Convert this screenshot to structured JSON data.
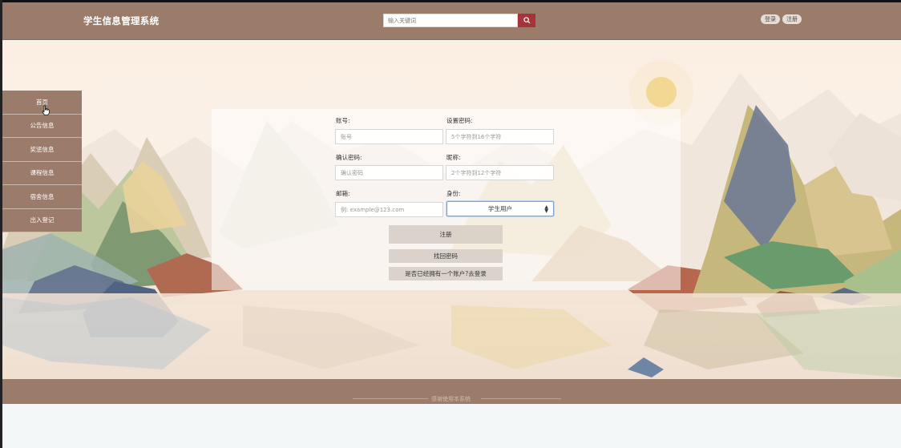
{
  "header": {
    "title": "学生信息管理系统",
    "search_placeholder": "输入关键词",
    "login_label": "登录",
    "register_label": "注册",
    "accent_color": "#9b7b6a",
    "search_button_color": "#a6323a"
  },
  "sidebar": {
    "items": [
      {
        "label": "首页"
      },
      {
        "label": "公告信息"
      },
      {
        "label": "奖惩信息"
      },
      {
        "label": "课程信息"
      },
      {
        "label": "宿舍信息"
      },
      {
        "label": "出入登记"
      }
    ]
  },
  "form": {
    "account_label": "账号:",
    "account_placeholder": "账号",
    "password_label": "设置密码:",
    "password_placeholder": "5个字符到16个字符",
    "confirm_label": "确认密码:",
    "confirm_placeholder": "确认密码",
    "nickname_label": "昵称:",
    "nickname_placeholder": "2个字符到12个字符",
    "email_label": "邮箱:",
    "email_placeholder": "例: example@123.com",
    "role_label": "身份:",
    "role_value": "学生用户",
    "submit_label": "注册",
    "recover_label": "找回密码",
    "login_link_label": "是否已经拥有一个账户?去登录"
  },
  "footer": {
    "text": "感谢使用本系统"
  },
  "icons": {
    "search": "search-icon",
    "select_arrow": "updown-chevron-icon",
    "cursor": "hand-cursor-icon"
  }
}
